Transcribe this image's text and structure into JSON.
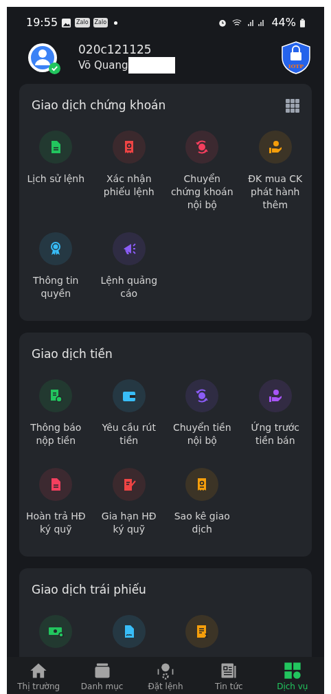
{
  "status_bar": {
    "time": "19:55",
    "notifications": [
      "Zalo",
      "Zalo"
    ],
    "battery": "44%"
  },
  "account": {
    "id": "020c121125",
    "name": "Võ Quang",
    "badge": "IOTP"
  },
  "sections": [
    {
      "title": "Giao dịch chứng khoán",
      "items": [
        {
          "label": "Lịch sử lệnh",
          "kind": "document",
          "color": "#22c55e"
        },
        {
          "label": "Xác nhận phiếu lệnh",
          "kind": "receipt",
          "color": "#ef4444"
        },
        {
          "label": "Chuyển chứng khoán nội bộ",
          "kind": "exchange",
          "color": "#f43f5e"
        },
        {
          "label": "ĐK mua CK phát hành thêm",
          "kind": "hand-coin",
          "color": "#f59e0b"
        },
        {
          "label": "Thông tin quyền",
          "kind": "medal",
          "color": "#38bdf8"
        },
        {
          "label": "Lệnh quảng cáo",
          "kind": "megaphone",
          "color": "#8b5cf6"
        }
      ]
    },
    {
      "title": "Giao dịch tiền",
      "items": [
        {
          "label": "Thông báo nộp tiền",
          "kind": "ledger",
          "color": "#22c55e"
        },
        {
          "label": "Yêu cầu rút tiền",
          "kind": "wallet",
          "color": "#38bdf8"
        },
        {
          "label": "Chuyển tiền nội bộ",
          "kind": "exchange",
          "color": "#8b5cf6"
        },
        {
          "label": "Ứng trước tiền bán",
          "kind": "hand-coin",
          "color": "#a855f7"
        },
        {
          "label": "Hoàn trả HĐ ký quỹ",
          "kind": "document",
          "color": "#f43f5e"
        },
        {
          "label": "Gia hạn HĐ ký quỹ",
          "kind": "sign",
          "color": "#ef4444"
        },
        {
          "label": "Sao kê giao dịch",
          "kind": "receipt",
          "color": "#f59e0b"
        }
      ]
    },
    {
      "title": "Giao dịch trái phiếu",
      "items": [
        {
          "kind": "cash",
          "color": "#22c55e"
        },
        {
          "kind": "contract",
          "color": "#38bdf8"
        },
        {
          "kind": "hourglass-doc",
          "color": "#f59e0b"
        }
      ]
    }
  ],
  "bottom_nav": [
    {
      "label": "Thị trường",
      "kind": "home",
      "selected": false
    },
    {
      "label": "Danh mục",
      "kind": "folder",
      "selected": false
    },
    {
      "label": "Đặt lệnh",
      "kind": "order",
      "selected": false
    },
    {
      "label": "Tin tức",
      "kind": "news",
      "selected": false
    },
    {
      "label": "Dịch vụ",
      "kind": "services",
      "selected": true
    }
  ]
}
